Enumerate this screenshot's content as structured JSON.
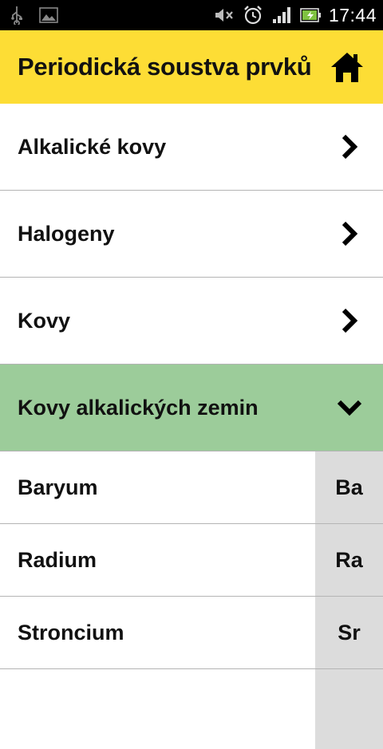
{
  "statusbar": {
    "time": "17:44",
    "icons": [
      "usb-icon",
      "image-icon",
      "mute-icon",
      "alarm-icon",
      "signal-icon",
      "battery-icon"
    ]
  },
  "header": {
    "title": "Periodická soustva prvků",
    "home_icon": "home-icon",
    "bg_color": "#fddd35"
  },
  "groups": [
    {
      "label": "Alkalické kovy",
      "state": "collapsed"
    },
    {
      "label": "Halogeny",
      "state": "collapsed"
    },
    {
      "label": "Kovy",
      "state": "collapsed"
    },
    {
      "label": "Kovy alkalických zemin",
      "state": "expanded"
    }
  ],
  "elements": [
    {
      "name": "Baryum",
      "symbol": "Ba"
    },
    {
      "name": "Radium",
      "symbol": "Ra"
    },
    {
      "name": "Stroncium",
      "symbol": "Sr"
    }
  ],
  "colors": {
    "expanded_bg": "#9ccc9a",
    "symbol_bg": "#dcdcdc",
    "divider": "#b4b4b4"
  }
}
